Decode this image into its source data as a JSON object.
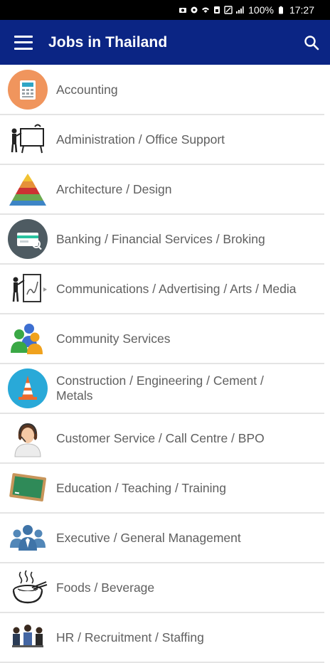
{
  "status": {
    "battery": "100%",
    "time": "17:27"
  },
  "app_bar": {
    "title": "Jobs in Thailand",
    "menu_icon": "hamburger-menu-icon",
    "search_icon": "search-icon"
  },
  "colors": {
    "app_bar": "#0b2584",
    "text": "#5f5f5f",
    "divider": "#e4e4e4"
  },
  "categories": [
    {
      "label": "Accounting",
      "icon": "calculator-icon"
    },
    {
      "label": "Administration / Office Support",
      "icon": "presentation-board-icon"
    },
    {
      "label": "Architecture / Design",
      "icon": "pyramid-icon"
    },
    {
      "label": "Banking / Financial Services / Broking",
      "icon": "bank-card-icon"
    },
    {
      "label": "Communications / Advertising / Arts / Media",
      "icon": "painter-icon"
    },
    {
      "label": "Community Services",
      "icon": "people-group-icon"
    },
    {
      "label": "Construction / Engineering / Cement / Metals",
      "icon": "traffic-cone-icon"
    },
    {
      "label": "Customer Service / Call Centre / BPO",
      "icon": "call-centre-agent-icon"
    },
    {
      "label": "Education / Teaching / Training",
      "icon": "chalkboard-icon"
    },
    {
      "label": "Executive / General Management",
      "icon": "executive-team-icon"
    },
    {
      "label": "Foods / Beverage",
      "icon": "noodle-bowl-icon"
    },
    {
      "label": "HR / Recruitment / Staffing",
      "icon": "staff-group-icon"
    }
  ]
}
